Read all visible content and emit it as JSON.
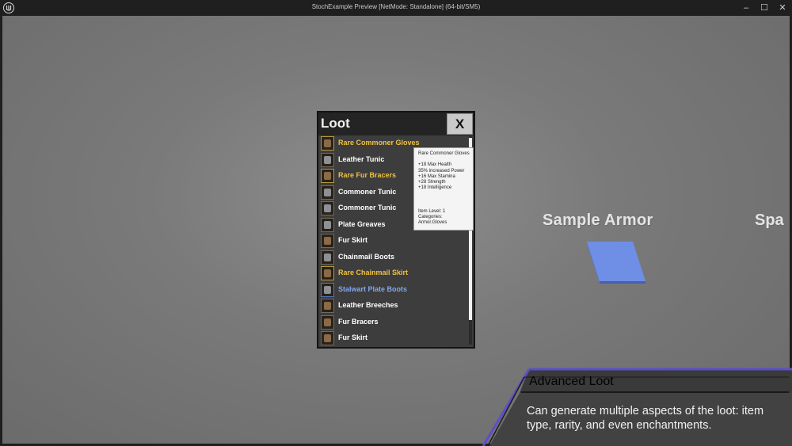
{
  "window": {
    "title": "StochExample Preview [NetMode: Standalone]  (64-bit/SM5)",
    "minimize": "–",
    "maximize": "☐",
    "close": "✕"
  },
  "loot": {
    "title": "Loot",
    "close_label": "X",
    "items": [
      {
        "label": "Rare Commoner Gloves",
        "rarity": "rare",
        "color": "#f0c040"
      },
      {
        "label": "Leather Tunic",
        "rarity": "common",
        "color": "#ffffff"
      },
      {
        "label": "Rare Fur Bracers",
        "rarity": "rare",
        "color": "#f0c040"
      },
      {
        "label": "Commoner Tunic",
        "rarity": "common",
        "color": "#ffffff"
      },
      {
        "label": "Commoner Tunic",
        "rarity": "common",
        "color": "#ffffff"
      },
      {
        "label": "Plate Greaves",
        "rarity": "common",
        "color": "#ffffff"
      },
      {
        "label": "Fur Skirt",
        "rarity": "common",
        "color": "#ffffff"
      },
      {
        "label": "Chainmail Boots",
        "rarity": "common",
        "color": "#ffffff"
      },
      {
        "label": "Rare Chainmail Skirt",
        "rarity": "rare",
        "color": "#f0c040"
      },
      {
        "label": "Stalwart Plate Boots",
        "rarity": "magic",
        "color": "#7fa7ee"
      },
      {
        "label": "Leather Breeches",
        "rarity": "common",
        "color": "#ffffff"
      },
      {
        "label": "Fur Bracers",
        "rarity": "common",
        "color": "#ffffff"
      },
      {
        "label": "Fur Skirt",
        "rarity": "common",
        "color": "#ffffff"
      }
    ]
  },
  "tooltip": {
    "name": "Rare Commoner Gloves",
    "stats": [
      "+18 Max Health",
      "35% increased Power",
      "+16 Max Stamina",
      "+28 Strength",
      "+18 Intelligence"
    ],
    "item_level": "Item Level: 1",
    "categories_label": "Categories:",
    "categories": "Armor.Gloves"
  },
  "scene": {
    "sample_armor": "Sample Armor",
    "partial_label": "Spa",
    "plane_color": "#6f8fe6"
  },
  "banner": {
    "title": "Advanced Loot",
    "text": "Can generate multiple aspects of the loot: item type, rarity, and even enchantments.",
    "accent": "#5b4fc8"
  }
}
